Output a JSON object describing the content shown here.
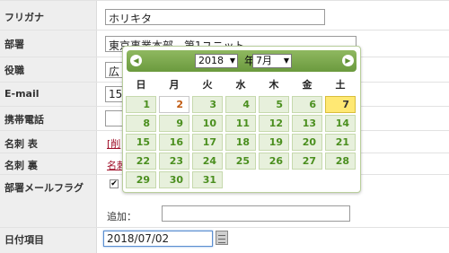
{
  "form": {
    "furigana_label": "フリガナ",
    "furigana_value": "ホリキタ",
    "department_label": "部署",
    "department_value": "東京事業本部　第1ユニット",
    "position_label": "役職",
    "position_value": "広",
    "email_label": "E-mail",
    "email_value": "15",
    "mobile_label": "携帯電話",
    "mobile_value": "",
    "card_front_label": "名刺 表",
    "card_front_link": "[削",
    "card_back_label": "名刺 裏",
    "card_back_link": "名刺",
    "dept_mail_flag_label": "部署メールフラグ",
    "dept_mail_checked": true,
    "add_label": "追加：",
    "add_value": "",
    "date_item_label": "日付項目",
    "date_value": "2018/07/02"
  },
  "calendar": {
    "year": "2018",
    "month": "7月",
    "year_suffix": "年",
    "prev_icon": "◀",
    "next_icon": "▶",
    "weekdays": [
      "日",
      "月",
      "火",
      "水",
      "木",
      "金",
      "土"
    ],
    "weeks": [
      [
        "",
        "1",
        "2",
        "3",
        "4",
        "5",
        "6",
        "7"
      ],
      [
        "",
        "8",
        "9",
        "10",
        "11",
        "12",
        "13",
        "14"
      ],
      [
        "",
        "15",
        "16",
        "17",
        "18",
        "19",
        "20",
        "21"
      ],
      [
        "",
        "22",
        "23",
        "24",
        "25",
        "26",
        "27",
        "28"
      ],
      [
        "",
        "29",
        "30",
        "31"
      ]
    ],
    "selected_day": "2",
    "today": "7",
    "colors": {
      "header": "#7aa84b",
      "cell": "#e7f0dc",
      "day_text": "#4b8f1f",
      "today": "#ffe873"
    }
  }
}
